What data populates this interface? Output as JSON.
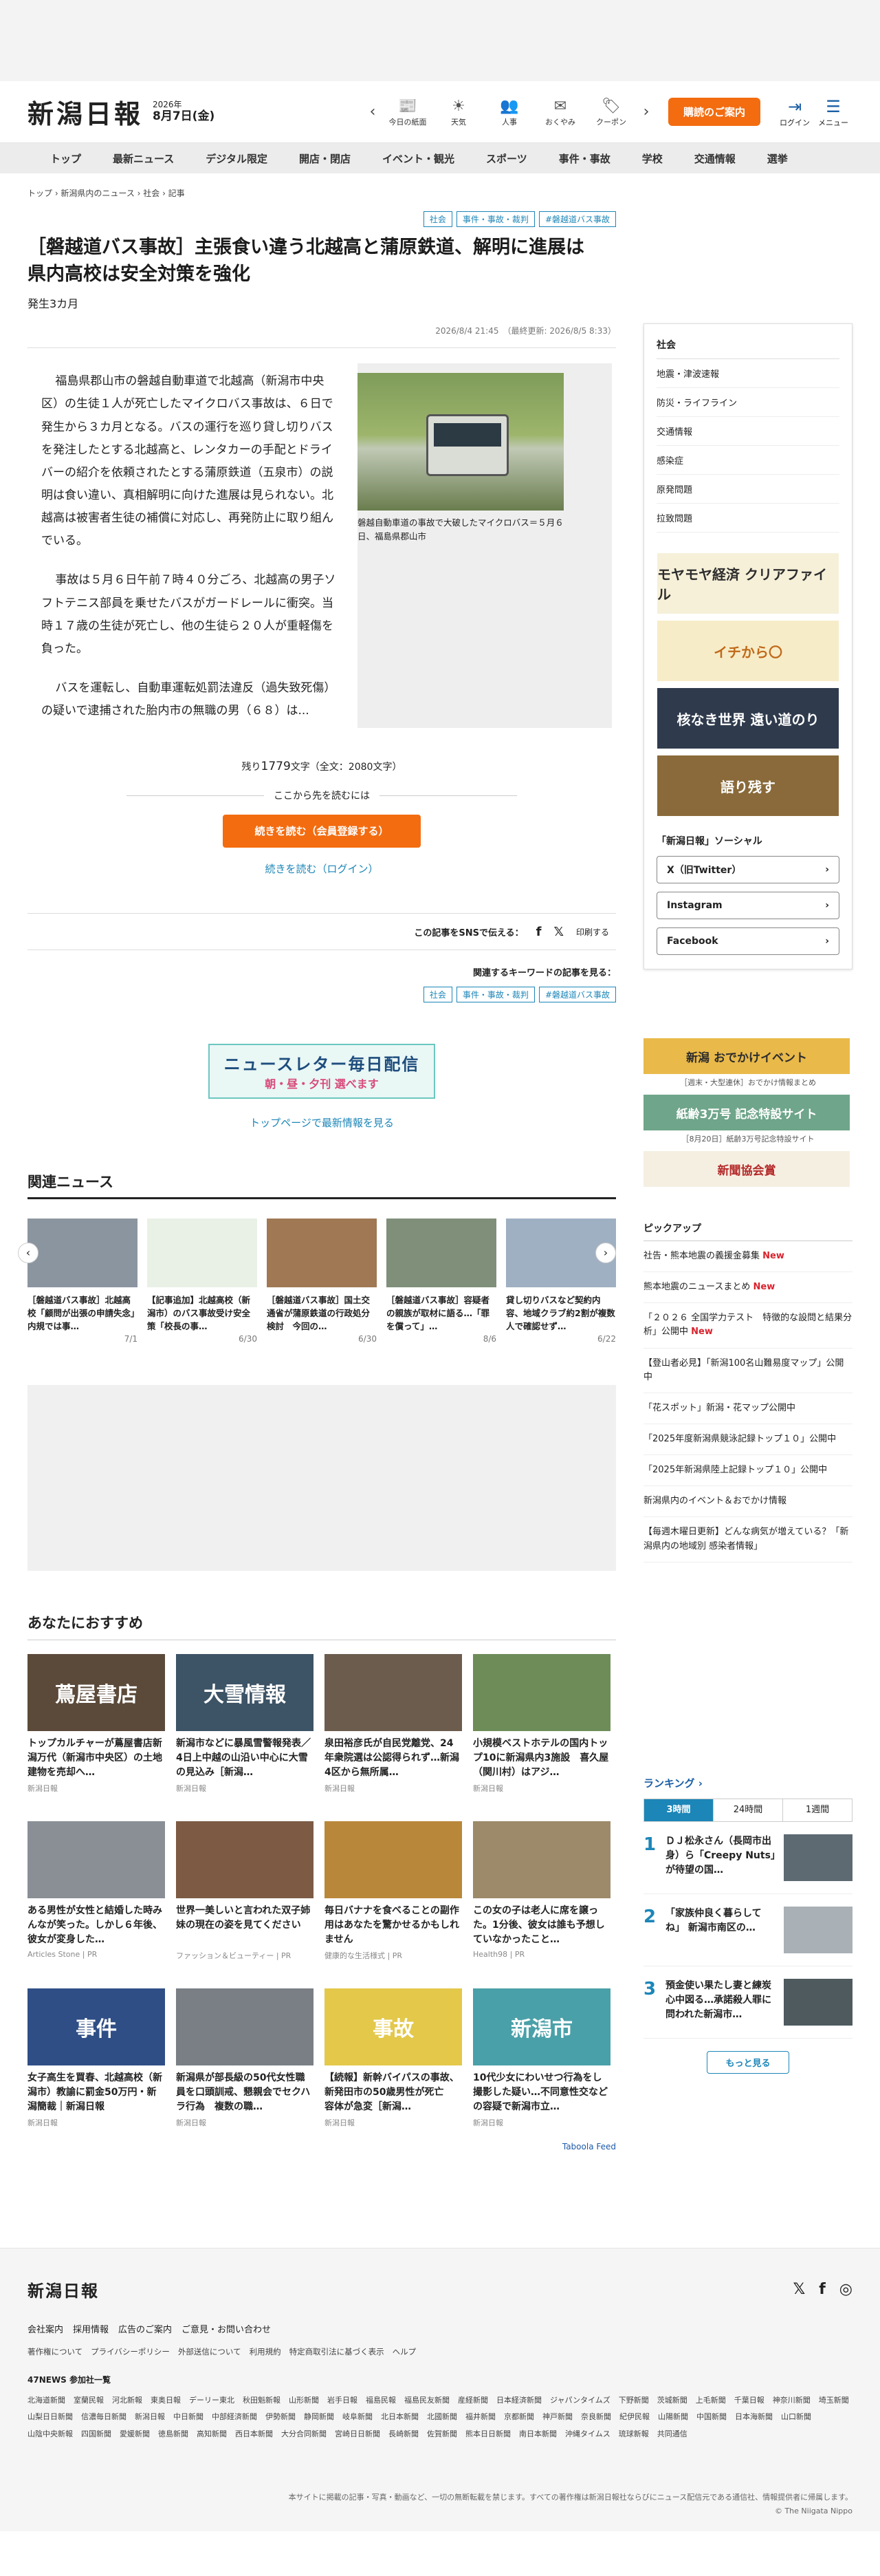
{
  "header": {
    "logo": "新潟日報",
    "year": "2026年",
    "date": "8月7日(金)",
    "nav_items": [
      {
        "icon": "📰",
        "label": "今日の紙面"
      },
      {
        "icon": "☀",
        "label": "天気"
      },
      {
        "icon": "👥",
        "label": "人事"
      },
      {
        "icon": "✉",
        "label": "おくやみ"
      },
      {
        "icon": "🏷",
        "label": "クーポン"
      }
    ],
    "cta": "購読のご案内",
    "login": "ログイン",
    "menu": "メニュー"
  },
  "global_nav": [
    "トップ",
    "最新ニュース",
    "デジタル限定",
    "開店・閉店",
    "イベント・観光",
    "スポーツ",
    "事件・事故",
    "学校",
    "交通情報",
    "選挙"
  ],
  "breadcrumb": "トップ › 新潟県内のニュース › 社会 › 記事",
  "article": {
    "tags": [
      "社会",
      "事件・事故・裁判",
      "#磐越道バス事故"
    ],
    "title": "［磐越道バス事故］主張食い違う北越高と蒲原鉄道、解明に進展は　県内高校は安全対策を強化",
    "elapsed": "発生3カ月",
    "timestamps": "2026/8/4 21:45　（最終更新: 2026/8/5 8:33）",
    "paragraphs": [
      "福島県郡山市の磐越自動車道で北越高（新潟市中央区）の生徒１人が死亡したマイクロバス事故は、６日で発生から３カ月となる。バスの運行を巡り貸し切りバスを発注したとする北越高と、レンタカーの手配とドライバーの紹介を依頼されたとする蒲原鉄道（五泉市）の説明は食い違い、真相解明に向けた進展は見られない。北越高は被害者生徒の補償に対応し、再発防止に取り組んでいる。",
      "事故は５月６日午前７時４０分ごろ、北越高の男子ソフトテニス部員を乗せたバスがガードレールに衝突。当時１７歳の生徒が死亡し、他の生徒ら２０人が重軽傷を負った。",
      "バスを運転し、自動車運転処罰法違反（過失致死傷）の疑いで逮捕された胎内市の無職の男（６８）は..."
    ],
    "photo_caption": "磐越自動車道の事故で大破したマイクロバス＝５月６日、福島県郡山市",
    "remain_prefix": "残り",
    "remain_count": "1779",
    "remain_suffix": "文字（全文：2080文字）",
    "continue_head": "ここから先を読むには",
    "continue_button": "続きを読む（会員登録する）",
    "login_link": "続きを読む（ログイン）",
    "share_label": "この記事をSNSで伝える：",
    "share_icons": [
      "f",
      "𝕏"
    ],
    "print_label": "印刷する",
    "keyword_title": "関連するキーワードの記事を見る："
  },
  "newsletter_banner": {
    "line1": "ニュースレター毎日配信",
    "line2": "朝・昼・夕刊 選べます"
  },
  "top_link": "トップページで最新情報を見る",
  "related": {
    "title": "関連ニュース",
    "items": [
      {
        "title": "［磐越道バス事故］北越高校「顧問が出張の申請失念」内規では事…",
        "date": "7/1",
        "color": "#8b95a0"
      },
      {
        "title": "【記事追加】北越高校（新潟市）のバス事故受け安全策「校長の事…",
        "date": "6/30",
        "color": "#e9f1e6"
      },
      {
        "title": "［磐越道バス事故］国土交通省が蒲原鉄道の行政処分検討　今回の…",
        "date": "6/30",
        "color": "#a07854"
      },
      {
        "title": "［磐越道バス事故］容疑者の親族が取材に語る…「罪を償って」…",
        "date": "8/6",
        "color": "#7f8f7a"
      },
      {
        "title": "貸し切りバスなど契約内容、地域クラブ約2割が複数人で確認せず…",
        "date": "6/22",
        "color": "#9fb0c2"
      }
    ]
  },
  "recommend": {
    "title": "あなたにおすすめ",
    "items": [
      {
        "title": "トップカルチャーが蔦屋書店新潟万代（新潟市中央区）の土地建物を売却へ…",
        "src": "新潟日報",
        "color": "#5b4a3a"
      },
      {
        "title": "新潟市などに暴風雪警報発表／4日上中越の山沿い中心に大雪の見込み［新潟…",
        "src": "新潟日報",
        "color": "#3d5366"
      },
      {
        "title": "泉田裕彦氏が自民党離党、24年衆院選は公認得られず…新潟4区から無所属…",
        "src": "新潟日報",
        "color": "#6b5c4d"
      },
      {
        "title": "小規模ベストホテルの国内トップ10に新潟県内3施設　喜久屋（関川村）はアジ…",
        "src": "新潟日報",
        "color": "#6e8c58"
      },
      {
        "title": "ある男性が女性と結婚した時みんなが笑った。しかし６年後、彼女が変身した…",
        "src": "Articles Stone | PR",
        "color": "#8a8f96"
      },
      {
        "title": "世界一美しいと言われた双子姉妹の現在の姿を見てください",
        "src": "ファッション＆ビューティー | PR",
        "color": "#7c5a44"
      },
      {
        "title": "毎日バナナを食べることの副作用はあなたを驚かせるかもしれません",
        "src": "健康的な生活様式 | PR",
        "color": "#b9873a"
      },
      {
        "title": "この女の子は老人に席を譲った。1分後、彼女は誰も予想していなかったこと…",
        "src": "Health98 | PR",
        "color": "#9c8a6a"
      },
      {
        "title": "女子高生を買春、北越高校（新潟市）教諭に罰金50万円・新潟簡裁｜新潟日報",
        "src": "新潟日報",
        "color": "#2f4e86"
      },
      {
        "title": "新潟県が部長級の50代女性職員を口頭訓戒、懇親会でセクハラ行為　複数の職…",
        "src": "新潟日報",
        "color": "#7a7f85"
      },
      {
        "title": "【続報】新幹バイパスの事故、新発田市の50歳男性が死亡　容体が急変［新潟…",
        "src": "新潟日報",
        "color": "#e3c84a"
      },
      {
        "title": "10代少女にわいせつ行為をし撮影した疑い…不同意性交などの容疑で新潟市立…",
        "src": "新潟日報",
        "color": "#4aa0a8"
      }
    ],
    "thumb_labels": [
      "蔦屋書店",
      "大雪情報",
      "",
      "",
      "",
      "",
      "",
      "",
      "事件",
      "",
      "事故",
      "新潟市"
    ],
    "taboola": "Taboola Feed"
  },
  "sidebar": {
    "category_head": "社会",
    "categories": [
      "地震・津波速報",
      "防災・ライフライン",
      "交通情報",
      "感染症",
      "原発問題",
      "拉致問題"
    ],
    "banners": [
      {
        "label": "モヤモヤ経済 クリアファイル",
        "color": "#f6f0d9",
        "fg": "#2d2d2d"
      },
      {
        "label": "イチから〇",
        "color": "#f7ecc8",
        "fg": "#c06a1a"
      },
      {
        "label": "核なき世界 遠い道のり",
        "color": "#2f3b4d",
        "fg": "#ffffff"
      },
      {
        "label": "語り残す",
        "color": "#8a6a3a",
        "fg": "#ffffff"
      }
    ],
    "sns_head": "「新潟日報」ソーシャル",
    "sns": [
      "X（旧Twitter）",
      "Instagram",
      "Facebook"
    ],
    "wide_banners": [
      {
        "label": "新潟 おでかけイベント",
        "caption": "［週末・大型連休］おでかけ情報まとめ",
        "color": "#e9b94a",
        "fg": "#2d2d2d"
      },
      {
        "label": "紙齢3万号 記念特設サイト",
        "caption": "［8月20日］紙齢3万号記念特設サイト",
        "color": "#6fa58a",
        "fg": "#ffffff"
      },
      {
        "label": "新聞協会賞",
        "caption": "",
        "color": "#f5efe2",
        "fg": "#b42a2a"
      }
    ],
    "pickup_head": "ピックアップ",
    "pickup": [
      {
        "text": "社告・熊本地震の義援金募集",
        "new": "New"
      },
      {
        "text": "熊本地震のニュースまとめ",
        "new": "New"
      },
      {
        "text": "「２０２６ 全国学力テスト　特徴的な設問と結果分析」公開中",
        "new": "New"
      },
      {
        "text": "【登山者必見】「新潟100名山難易度マップ」公開中",
        "new": ""
      },
      {
        "text": "「花スポット」新潟・花マップ公開中",
        "new": ""
      },
      {
        "text": "「2025年度新潟県競泳記録トップ１０」公開中",
        "new": ""
      },
      {
        "text": "「2025年新潟県陸上記録トップ１０」公開中",
        "new": ""
      },
      {
        "text": "新潟県内のイベント＆おでかけ情報",
        "new": ""
      },
      {
        "text": "【毎週木曜日更新】どんな病気が増えている？「新潟県内の地域別 感染者情報」",
        "new": ""
      }
    ],
    "ranking_head": "ランキング ›",
    "ranking_tabs": [
      "3時間",
      "24時間",
      "1週間"
    ],
    "ranking": [
      {
        "num": "1",
        "text": "ＤＪ松永さん（長岡市出身）ら「Creepy Nuts」が待望の国…",
        "color": "#5e6a72"
      },
      {
        "num": "2",
        "text": "「家族仲良く暮らしてね」 新潟市南区の…",
        "color": "#a9b0b6"
      },
      {
        "num": "3",
        "text": "預金使い果たし妻と練炭心中図る…承諾殺人罪に問われた新潟市…",
        "color": "#4e5a5e"
      }
    ],
    "more": "もっと見る"
  },
  "footer": {
    "logo": "新潟日報",
    "social": [
      "𝕏",
      "f",
      "◎"
    ],
    "links": [
      "会社案内",
      "採用情報",
      "広告のご案内",
      "ご意見・お問い合わせ"
    ],
    "links2": [
      "著作権について",
      "プライバシーポリシー",
      "外部送信について",
      "利用規約",
      "特定商取引法に基づく表示",
      "ヘルプ"
    ],
    "net_head": "47NEWS 参加社一覧",
    "papers": [
      "北海道新聞",
      "室蘭民報",
      "河北新報",
      "東奥日報",
      "デーリー東北",
      "秋田魁新報",
      "山形新聞",
      "岩手日報",
      "福島民報",
      "福島民友新聞",
      "産経新聞",
      "日本経済新聞",
      "ジャパンタイムズ",
      "下野新聞",
      "茨城新聞",
      "上毛新聞",
      "千葉日報",
      "神奈川新聞",
      "埼玉新聞",
      "山梨日日新聞",
      "信濃毎日新聞",
      "新潟日報",
      "中日新聞",
      "中部経済新聞",
      "伊勢新聞",
      "静岡新聞",
      "岐阜新聞",
      "北日本新聞",
      "北國新聞",
      "福井新聞",
      "京都新聞",
      "神戸新聞",
      "奈良新聞",
      "紀伊民報",
      "山陽新聞",
      "中国新聞",
      "日本海新聞",
      "山口新聞",
      "山陰中央新報",
      "四国新聞",
      "愛媛新聞",
      "徳島新聞",
      "高知新聞",
      "西日本新聞",
      "大分合同新聞",
      "宮崎日日新聞",
      "長崎新聞",
      "佐賀新聞",
      "熊本日日新聞",
      "南日本新聞",
      "沖縄タイムス",
      "琉球新報",
      "共同通信"
    ],
    "notice": "本サイトに掲載の記事・写真・動画など、一切の無断転載を禁じます。すべての著作権は新潟日報社ならびにニュース配信元である通信社、情報提供者に帰属します。",
    "copyright": "© The Niigata Nippo"
  }
}
